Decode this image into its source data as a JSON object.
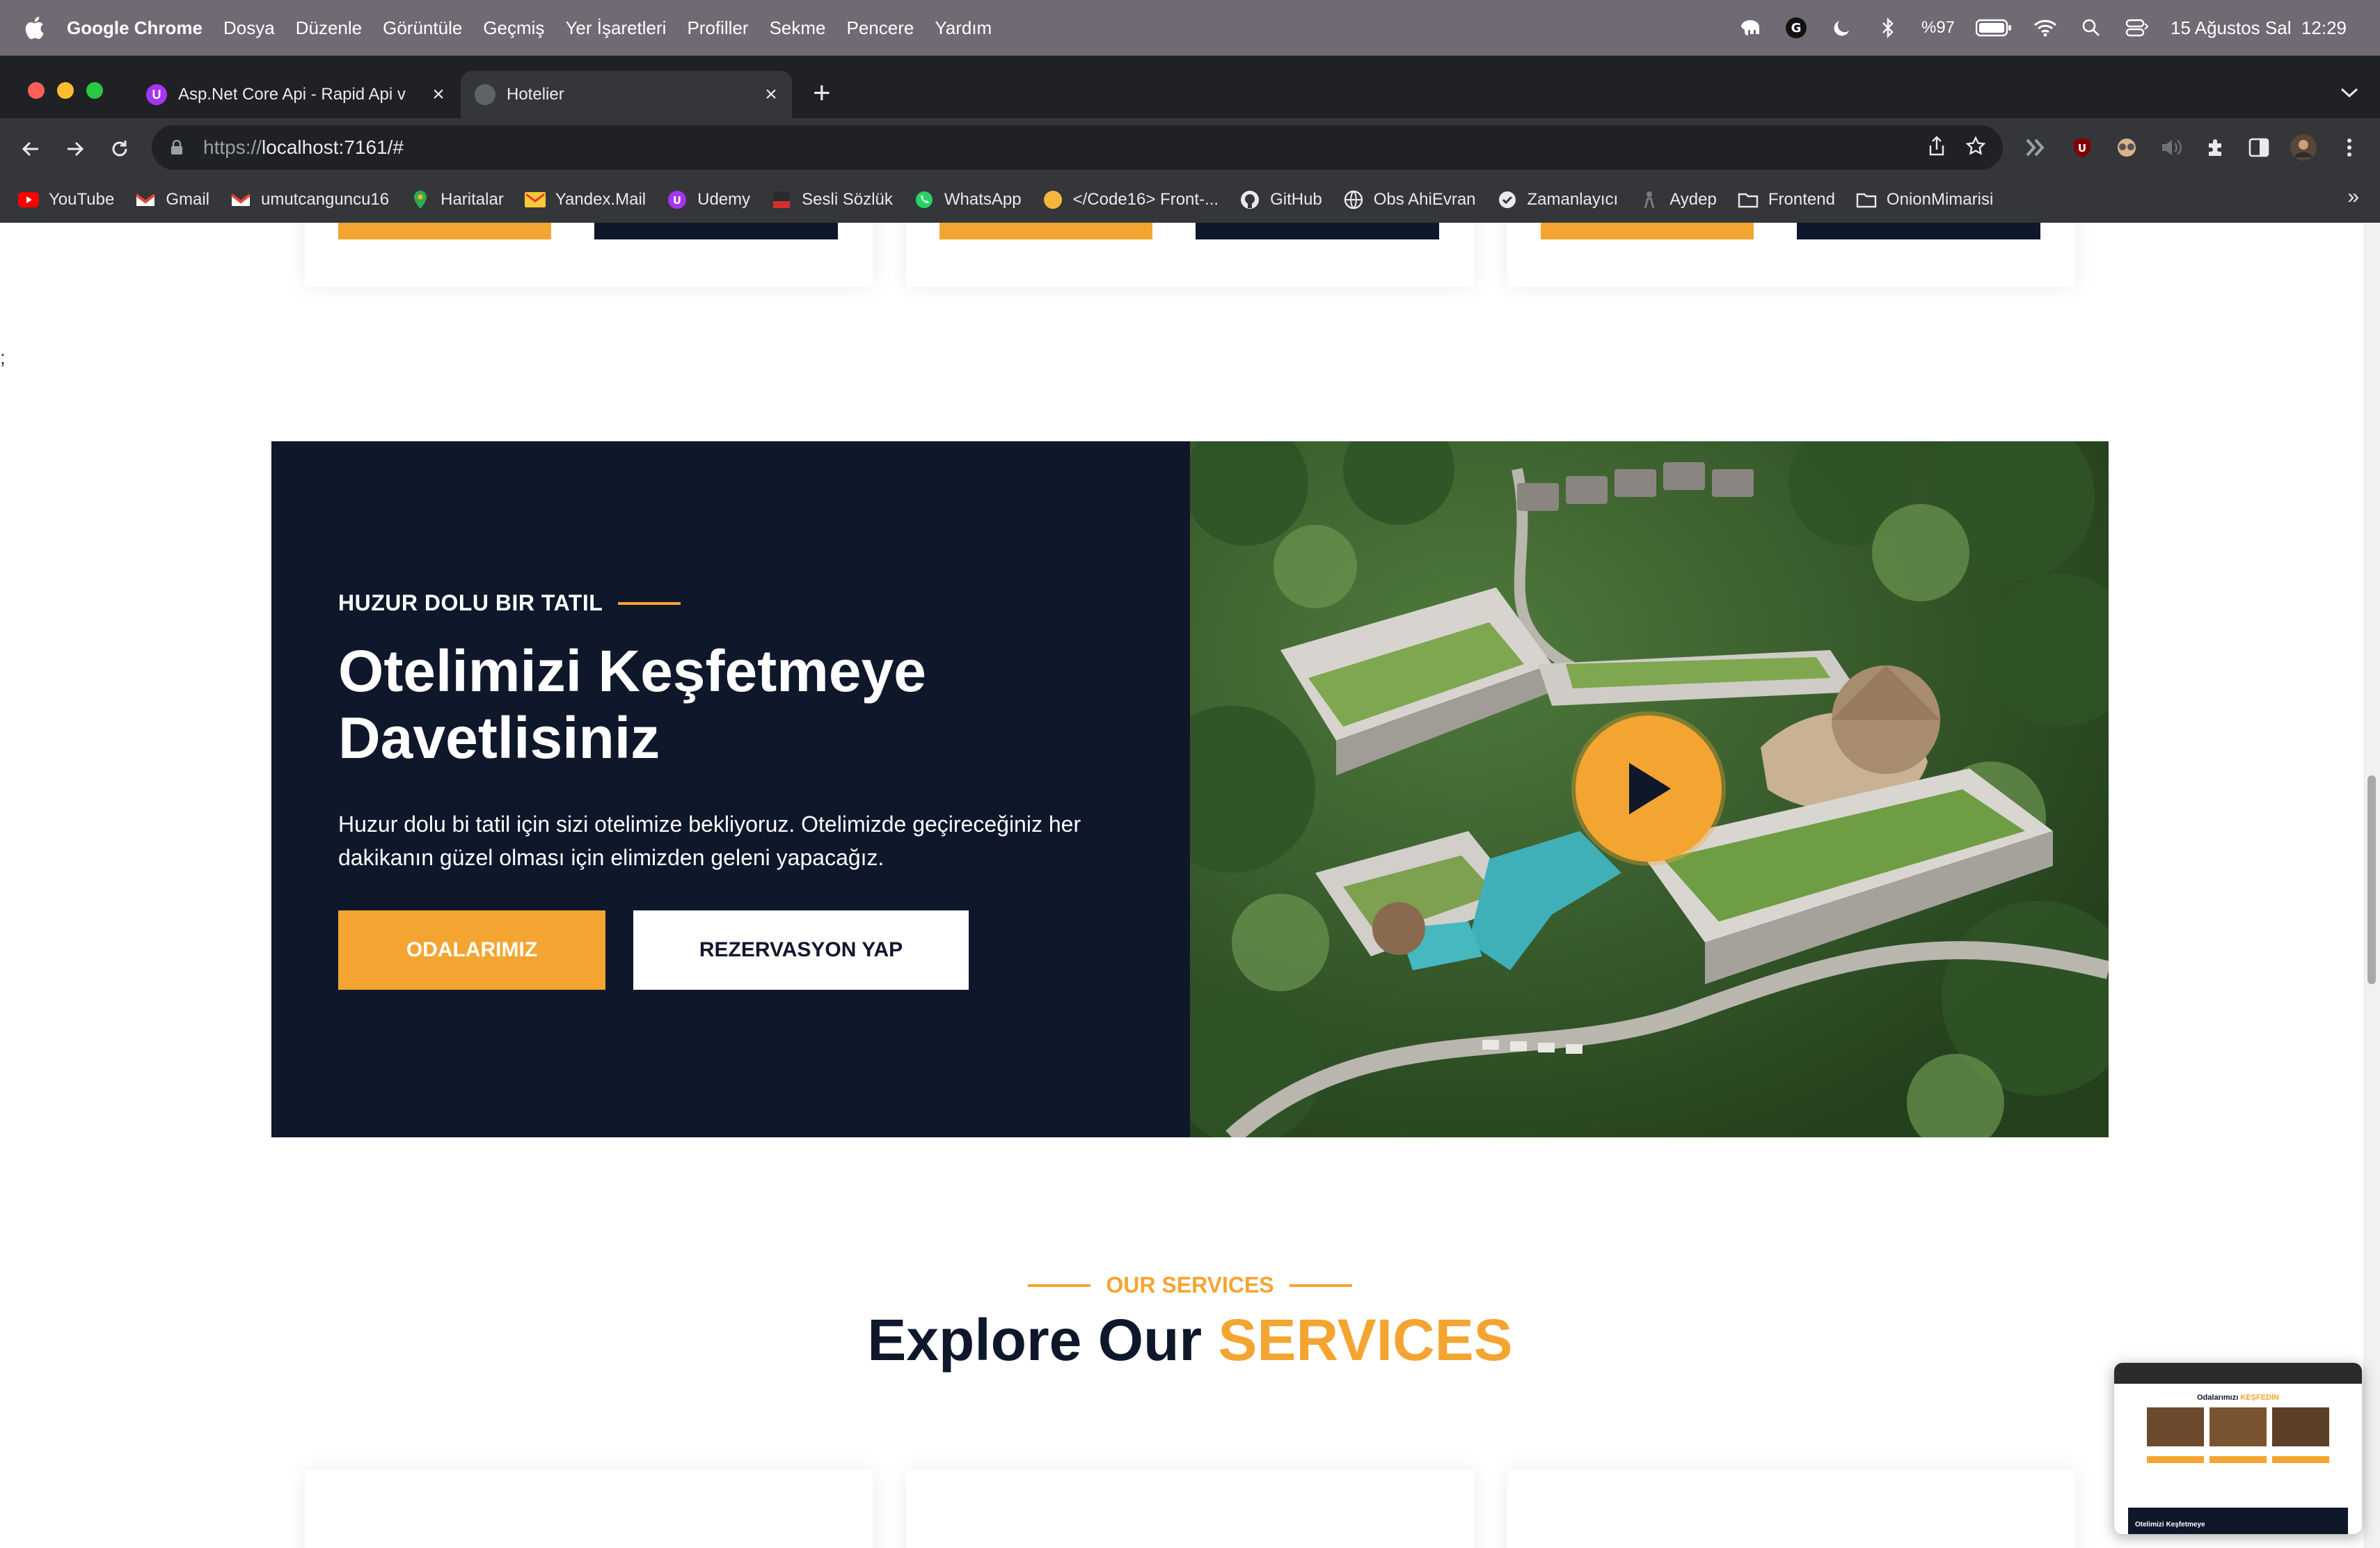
{
  "menubar": {
    "app_name": "Google Chrome",
    "items": [
      "Dosya",
      "Düzenle",
      "Görüntüle",
      "Geçmiş",
      "Yer İşaretleri",
      "Profiller",
      "Sekme",
      "Pencere",
      "Yardım"
    ],
    "battery": "%97",
    "datetime": "15 Ağustos Sal  12:29"
  },
  "tabs": [
    {
      "title": "Asp.Net Core Api - Rapid Api v",
      "favicon": "U",
      "active": false
    },
    {
      "title": "Hotelier",
      "favicon": "",
      "active": true
    }
  ],
  "address_bar": {
    "scheme": "https://",
    "host": "localhost:7161/#"
  },
  "bookmarks": [
    {
      "label": "YouTube",
      "icon": "youtube-icon"
    },
    {
      "label": "Gmail",
      "icon": "gmail-icon"
    },
    {
      "label": "umutcanguncu16",
      "icon": "gmail-icon"
    },
    {
      "label": "Haritalar",
      "icon": "maps-icon"
    },
    {
      "label": "Yandex.Mail",
      "icon": "mail-icon"
    },
    {
      "label": "Udemy",
      "icon": "udemy-icon"
    },
    {
      "label": "Sesli Sözlük",
      "icon": "dictionary-icon"
    },
    {
      "label": "WhatsApp",
      "icon": "whatsapp-icon"
    },
    {
      "label": "</Code16> Front-...",
      "icon": "code-icon"
    },
    {
      "label": "GitHub",
      "icon": "github-icon"
    },
    {
      "label": "Obs AhiEvran",
      "icon": "globe-icon"
    },
    {
      "label": "Zamanlayıcı",
      "icon": "check-icon"
    },
    {
      "label": "Aydep",
      "icon": "aydep-icon"
    },
    {
      "label": "Frontend",
      "icon": "folder-icon"
    },
    {
      "label": "OnionMimarisi",
      "icon": "folder-icon"
    }
  ],
  "page": {
    "stray_text": ";",
    "about": {
      "subtitle": "HUZUR DOLU BIR TATIL",
      "headline": "Otelimizi Keşfetmeye Davetlisiniz",
      "description": "Huzur dolu bi tatil için sizi otelimize bekliyoruz. Otelimizde geçireceğiniz her dakikanın güzel olması için elimizden geleni yapacağız.",
      "primary_button": "ODALARIMIZ",
      "secondary_button": "REZERVASYON YAP"
    },
    "services": {
      "subtitle": "OUR SERVICES",
      "title_main": "Explore Our",
      "title_accent": "SERVICES"
    }
  },
  "thumbnail": {
    "title_main": "Odalarımızı",
    "title_accent": "KEŞFEDİN",
    "footer_text": "Otelimizi Keşfetmeye"
  },
  "colors": {
    "accent": "#f4a531",
    "dark": "#0f172b",
    "chrome_dark": "#202124",
    "chrome_toolbar": "#35363a"
  }
}
